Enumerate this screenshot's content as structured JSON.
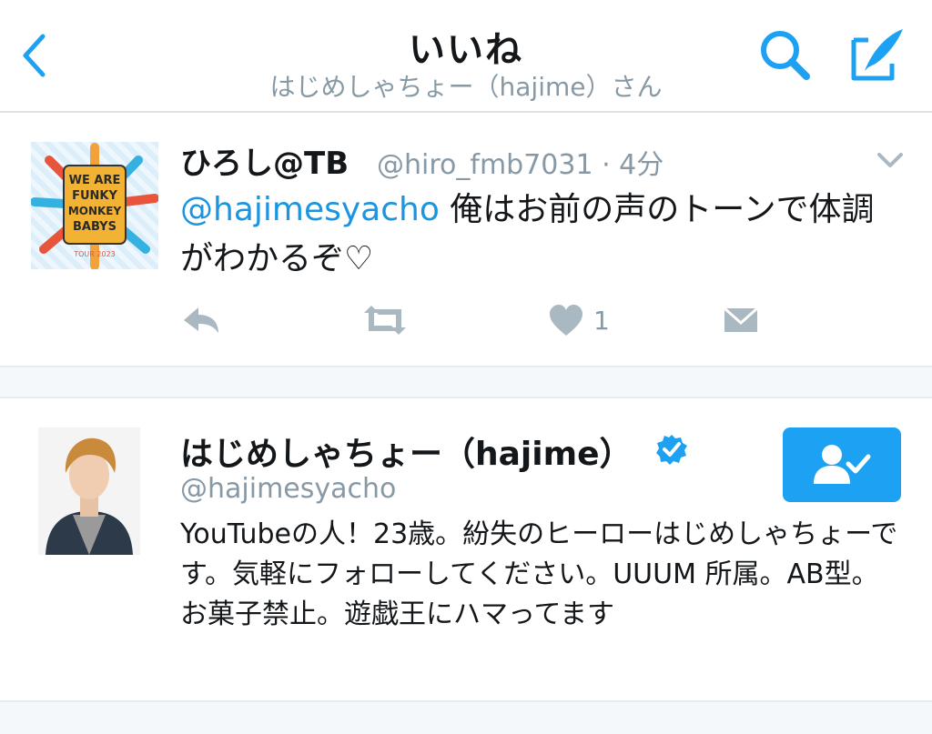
{
  "header": {
    "title": "いいね",
    "subtitle": "はじめしゃちょー（hajime）さん",
    "icons": {
      "back": "chevron-left-icon",
      "search": "search-icon",
      "compose": "compose-icon"
    },
    "accent_color": "#1da1f2"
  },
  "tweet": {
    "author_name": "ひろし@TB",
    "author_handle": "@hiro_fmb7031 · 4分",
    "mention": "@hajimesyacho",
    "text": " 俺はお前の声のトーンで体調がわかるぞ♡",
    "like_count": "1",
    "avatar_text": "WE ARE FUNKY MONKEY BABYS",
    "avatar_small_text": "TOUR 2023",
    "actions": [
      "reply-icon",
      "retweet-icon",
      "heart-icon",
      "direct-message-icon"
    ]
  },
  "profile": {
    "name": "はじめしゃちょー（hajime）",
    "handle": "@hajimesyacho",
    "verified": true,
    "bio": "YouTubeの人！23歳。紛失のヒーローはじめしゃちょーです。気軽にフォローしてください。UUUM 所属。AB型。お菓子禁止。遊戯王にハマってます",
    "follow_state": "following",
    "follow_icon": "user-check-icon"
  }
}
